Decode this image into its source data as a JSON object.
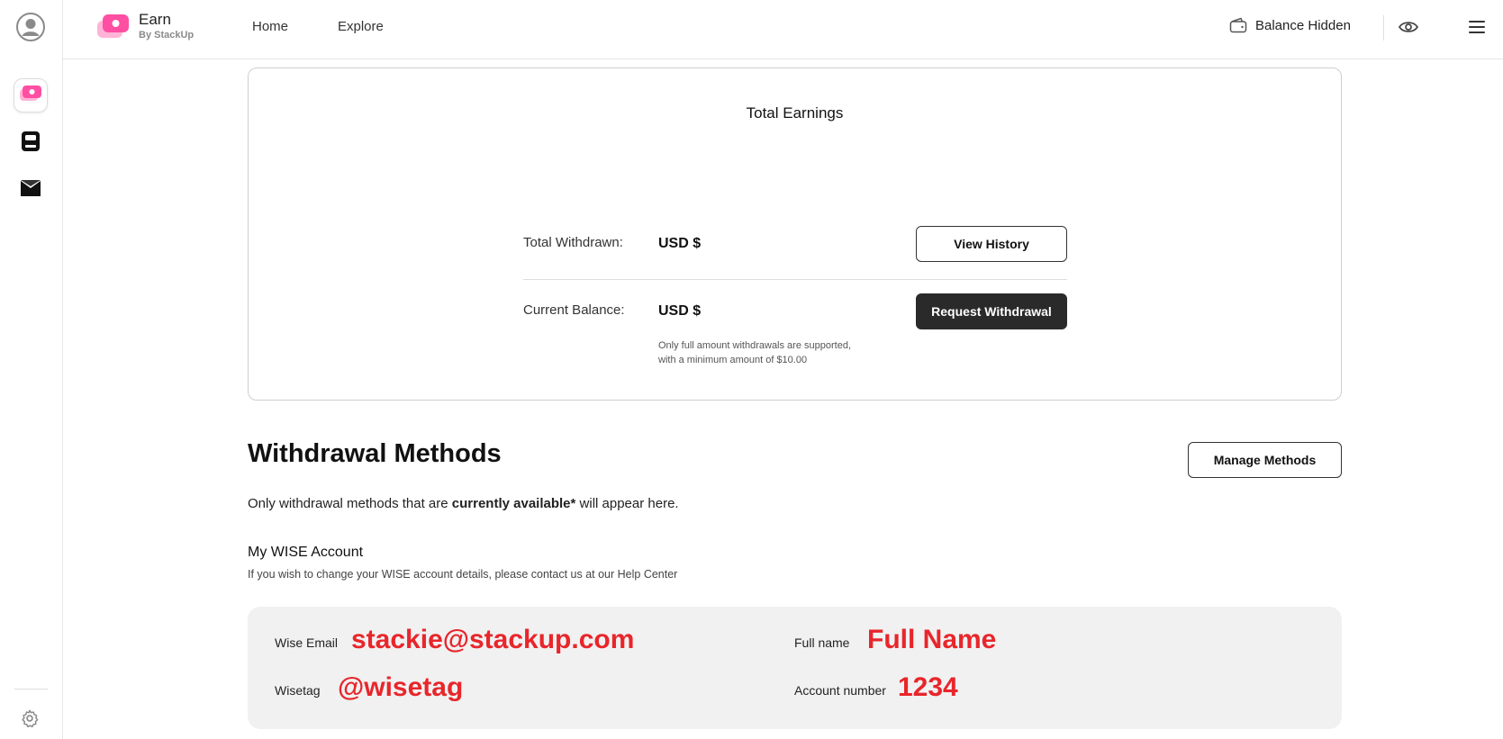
{
  "rail": {
    "icons": [
      "avatar-icon",
      "earn-icon",
      "book-icon",
      "mail-icon",
      "gear-icon"
    ]
  },
  "topbar": {
    "brand_title": "Earn",
    "brand_subtitle": "By StackUp",
    "nav": [
      "Home",
      "Explore"
    ],
    "balance_label": "Balance Hidden"
  },
  "earnings": {
    "title": "Total Earnings",
    "total_withdrawn_label": "Total Withdrawn:",
    "total_withdrawn_value": "USD $",
    "view_history_label": "View History",
    "current_balance_label": "Current Balance:",
    "current_balance_value": "USD $",
    "request_withdrawal_label": "Request Withdrawal",
    "note_line1": "Only full amount withdrawals are supported,",
    "note_line2": "with a minimum amount of $10.00"
  },
  "withdrawal_methods": {
    "title": "Withdrawal Methods",
    "manage_label": "Manage Methods",
    "desc_pre": "Only withdrawal methods that are ",
    "desc_bold": "currently available*",
    "desc_post": " will appear here."
  },
  "wise": {
    "title": "My WISE Account",
    "subtitle": "If you wish to change your WISE account details, please contact us at our Help Center",
    "email_label": "Wise Email",
    "email_value": "stackie@stackup.com",
    "fullname_label": "Full name",
    "fullname_value": "Full Name",
    "wisetag_label": "Wisetag",
    "wisetag_value": "@wisetag",
    "account_label": "Account number",
    "account_value": "1234"
  },
  "colors": {
    "brand_pink": "#ff4fa3",
    "brand_pink_light": "#ffb3d6",
    "dark_button": "#2a2a2a",
    "overlay_red": "#e8262b"
  }
}
